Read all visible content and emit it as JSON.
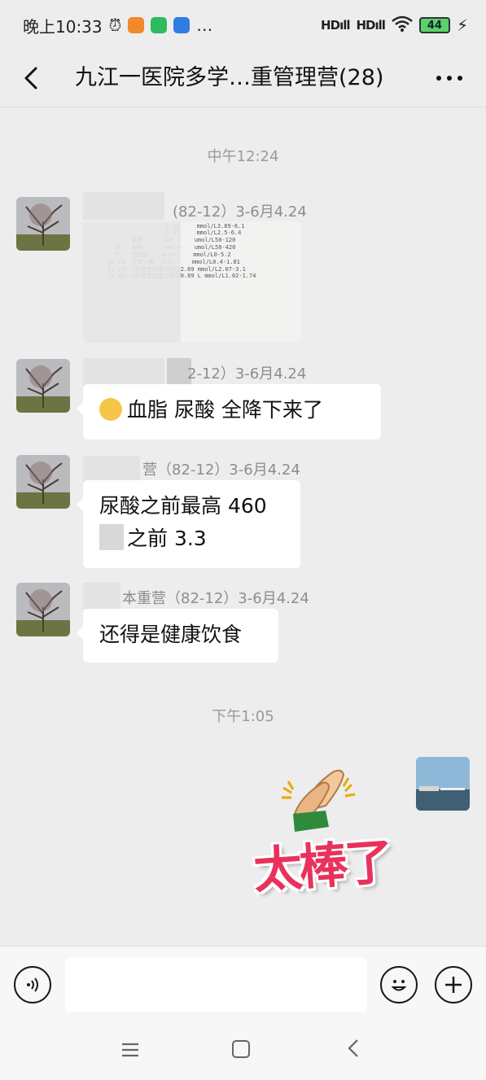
{
  "status_bar": {
    "time": "晚上10:33",
    "alarm_icon": "alarm-clock-icon",
    "notification_dots": "…",
    "signal_1": "HD",
    "signal_2": "HD",
    "battery": "44",
    "colors": {
      "app1": "#f08a2b",
      "app2": "#2dbb5d",
      "app3": "#2f7de1",
      "battery_fill": "#5ad16a"
    }
  },
  "nav": {
    "back_icon": "back-chevron-icon",
    "title": "九江一医院多学…重管理营(28)",
    "more_icon": "more-dots-icon"
  },
  "chat": {
    "timestamp_1": "中午12:24",
    "messages": [
      {
        "sender": "(82-12）3-6月4.24",
        "type": "image",
        "image_rows": [
          "                 4.58     mmol/L3.89-6.1",
          "                 5.07     mmol/L2.5-6.4",
          "       肌酐      107.7    umol/L50-120",
          "  UA   尿酸      348.4    umol/L50-420",
          "  TC   胆固醇    4.61     mmol/L0-5.2",
          "10 TG  甘油三酯  1.01     mmol/L0.4-1.81",
          "11 LDL-C低密度脂蛋白胆固2.69 mmol/L2.07-3.1",
          "12 HDL-C高密度脂蛋白胆固0.89 L mmol/L1.02-1.74"
        ]
      },
      {
        "sender": "2-12）3-6月4.24",
        "type": "text",
        "text": "血脂  尿酸  全降下来了"
      },
      {
        "sender": "营（82-12）3-6月4.24",
        "type": "text",
        "line1": "尿酸之前最高 460",
        "line2": "之前 3.3"
      },
      {
        "sender": "本重营（82-12）3-6月4.24",
        "type": "text",
        "text": "还得是健康饮食"
      }
    ],
    "timestamp_2": "下午1:05",
    "sticker_text": "太棒了"
  },
  "input_bar": {
    "voice_icon": "voice-icon",
    "emoji_icon": "emoji-icon",
    "plus_icon": "plus-icon",
    "placeholder": ""
  },
  "system_nav": {
    "menu_icon": "menu-icon",
    "home_icon": "home-icon",
    "back_icon": "back-icon"
  }
}
